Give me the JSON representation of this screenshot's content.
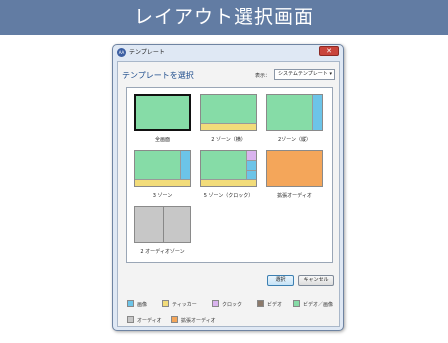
{
  "banner": {
    "title": "レイアウト選択画面"
  },
  "window": {
    "app_icon": "AA",
    "title": "テンプレート",
    "close": "✕"
  },
  "dialog": {
    "heading": "テンプレートを選択",
    "show_label": "表示：",
    "select_value": "システムテンプレート",
    "caret": "▾"
  },
  "layouts": [
    {
      "label": "全画面",
      "selected": true
    },
    {
      "label": "2 ゾーン（横）",
      "selected": false
    },
    {
      "label": "2ゾーン（縦）",
      "selected": false
    },
    {
      "label": "3 ゾーン",
      "selected": false
    },
    {
      "label": "5 ゾーン（クロック）",
      "selected": false
    },
    {
      "label": "拡張オーディオ",
      "selected": false
    },
    {
      "label": "2 オーディオゾーン",
      "selected": false
    }
  ],
  "buttons": {
    "select": "選択",
    "cancel": "キャンセル"
  },
  "legend": [
    {
      "label": "画像",
      "color": "#6cc4e8"
    },
    {
      "label": "ティッカー",
      "color": "#f2dc7a"
    },
    {
      "label": "クロック",
      "color": "#d9b3ee"
    },
    {
      "label": "ビデオ",
      "color": "#8c7a6b"
    },
    {
      "label": "ビデオ／画像",
      "color": "#86dca7"
    },
    {
      "label": "オーディオ",
      "color": "#c7c7c7"
    },
    {
      "label": "拡張オーディオ",
      "color": "#f4a65a"
    }
  ]
}
